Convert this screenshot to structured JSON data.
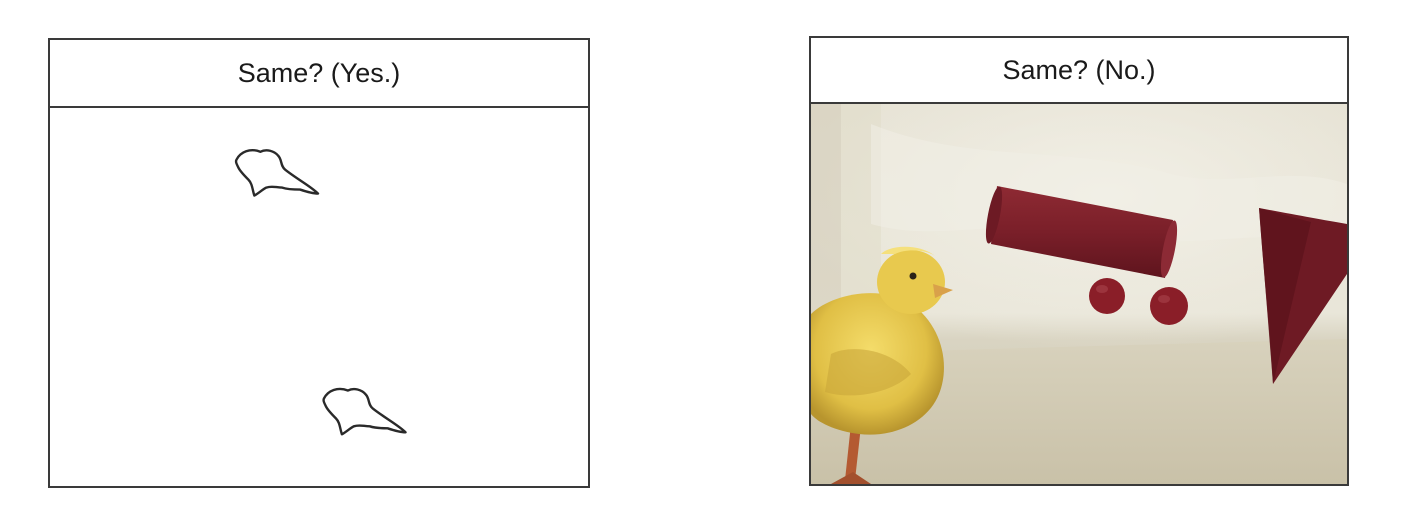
{
  "panels": [
    {
      "header": "Same? (Yes.)"
    },
    {
      "header": "Same? (No.)"
    }
  ]
}
